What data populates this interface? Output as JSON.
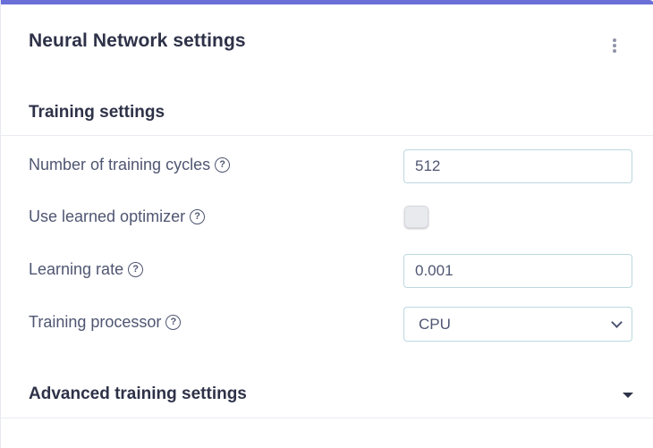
{
  "card": {
    "title": "Neural Network settings",
    "menu_icon": "kebab-vertical-icon",
    "accent_color": "#6b6fd8"
  },
  "training_settings": {
    "title": "Training settings",
    "help_icon": "question-circle-icon",
    "help_glyph": "?",
    "fields": [
      {
        "label": "Number of training cycles",
        "value": "512"
      },
      {
        "label": "Use learned optimizer",
        "checked": false
      },
      {
        "label": "Learning rate",
        "value": "0.001"
      },
      {
        "label": "Training processor",
        "selected": "CPU"
      }
    ]
  },
  "advanced": {
    "title": "Advanced training settings",
    "toggle_icon": "caret-down-icon"
  }
}
